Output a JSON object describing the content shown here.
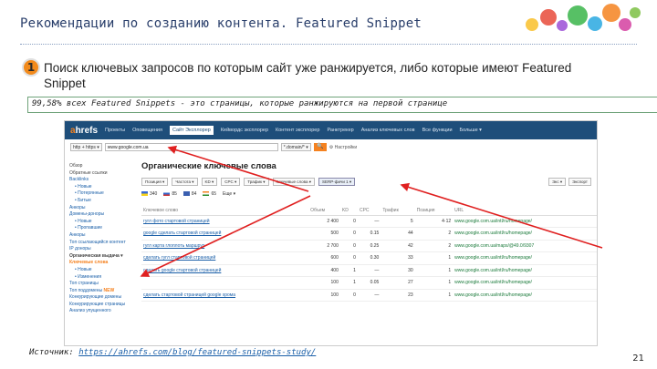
{
  "slide": {
    "title": "Рекомендации по созданию контента. Featured Snippet",
    "item_number": "1",
    "intro": "Поиск ключевых запросов по которым сайт уже ранжируется, либо которые имеют Featured Snippet",
    "highlight": "99,58% всех Featured Snippets - это страницы, которые ранжируются на первой странице",
    "source_label": "Источник:",
    "source_url": "https://ahrefs.com/blog/featured-snippets-study/",
    "page_number": "21"
  },
  "ahrefs": {
    "logo_a": "a",
    "logo_rest": "hrefs",
    "nav": [
      "Проекты",
      "Оповещения",
      "Сайт Эксплорер",
      "Кейвордс эксплорер",
      "Контент эксплорер",
      "Ранктрекер",
      "Анализ ключевых слов",
      "Все функции",
      "Больше ▾"
    ],
    "protocol": "http + https ▾",
    "url": "www.google.com.ua",
    "scope": "*.domain/* ▾",
    "settings": "⚙ Настройки",
    "go": "🔍",
    "sidebar": {
      "overview": "Обзор",
      "backlinks_head": "Обратные ссылки",
      "backlinks": "Backlinks",
      "bl_new": "• Новые",
      "bl_lost": "• Потерянные",
      "bl_broken": "• Битые",
      "anchors": "Анкоры",
      "ref_domains": "Домены-доноры",
      "rd_new": "• Новые",
      "rd_lost": "• Пропавшие",
      "anchors2": "Анкоры",
      "top_content": "Топ ссылающийся контент",
      "ip": "IP доноры",
      "organic": "Органическая выдача ▾",
      "keywords": "Ключевые слова",
      "kw_new": "• Новые",
      "kw_moves": "• Изменения",
      "top_pages": "Топ страницы",
      "top_subdomains": "Топ поддомены",
      "top_subdomains_badge": "NEW",
      "competing_domains": "Конкурирующие домены",
      "competing_pages": "Конкурирующие страницы",
      "content_gap": "Анализ упущенного"
    },
    "heading": "Органические ключевые слова",
    "filters": [
      "Позиция ▾",
      "Частота ▾",
      "KD ▾",
      "CPC ▾",
      "Трафик ▾",
      "Ключевые слова ▾",
      "SERP-фичи 1 ▾"
    ],
    "export": [
      "Экс ▾",
      "Экспорт"
    ],
    "countries": [
      {
        "name": "340",
        "color": "#3a6ad6"
      },
      {
        "name": "85",
        "color": "#c33"
      },
      {
        "name": "84",
        "color": "#c33"
      },
      {
        "name": "65",
        "color": "#f58220"
      },
      {
        "name": "Еще ▾",
        "color": ""
      }
    ],
    "columns": [
      "Ключевое слово",
      "Объем",
      "KD",
      "CPC",
      "Трафик",
      "Позиция",
      "URL"
    ],
    "rows": [
      {
        "kw": "гугл фото стартовой страницей",
        "vol": "2 400",
        "kd": "0",
        "cpc": "—",
        "traffic": "5",
        "pos": "4·12",
        "url": "www.google.com.ua/intl/ru/homepage/"
      },
      {
        "kw": "google сделать стартовой страницей",
        "vol": "500",
        "kd": "0",
        "cpc": "0.15",
        "traffic": "44",
        "pos": "2",
        "url": "www.google.com.ua/intl/ru/homepage/"
      },
      {
        "kw": "гугл карта глоплоть маршрут",
        "vol": "2 700",
        "kd": "0",
        "cpc": "0.25",
        "traffic": "42",
        "pos": "2",
        "url": "www.google.com.ua/maps/@49.0/9307"
      },
      {
        "kw": "сделать гугл стартовой страницей",
        "vol": "600",
        "kd": "0",
        "cpc": "0.30",
        "traffic": "33",
        "pos": "1",
        "url": "www.google.com.ua/intl/ru/homepage/"
      },
      {
        "kw": "сделать google стартовой страницей",
        "vol": "400",
        "kd": "1",
        "cpc": "—",
        "traffic": "30",
        "pos": "1",
        "url": "www.google.com.ua/intl/ru/homepage/"
      },
      {
        "kw": "",
        "vol": "100",
        "kd": "1",
        "cpc": "0.05",
        "traffic": "27",
        "pos": "1",
        "url": "www.google.com.ua/intl/ru/homepage/"
      },
      {
        "kw": "сделать стартовой страницей google хрома",
        "vol": "100",
        "kd": "0",
        "cpc": "—",
        "traffic": "23",
        "pos": "1",
        "url": "www.google.com.ua/intl/ru/homepage/"
      }
    ]
  },
  "colors": {
    "accent": "#f58220",
    "title": "#2a3f6b",
    "arrow": "#e02020",
    "topbar": "#1e4e7a"
  }
}
